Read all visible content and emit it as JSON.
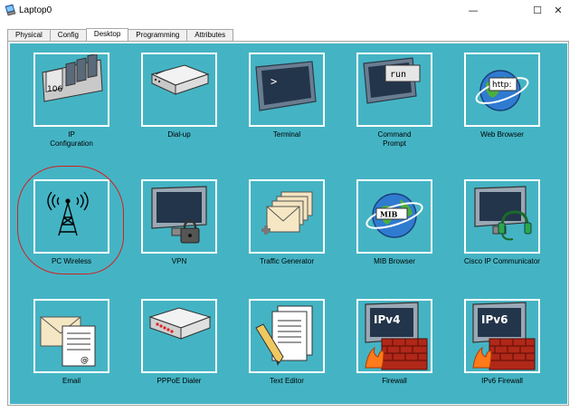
{
  "window": {
    "title": "Laptop0",
    "minimize_glyph": "—",
    "maximize_glyph": "☐",
    "close_glyph": "✕"
  },
  "tabs": [
    {
      "label": "Physical",
      "active": false
    },
    {
      "label": "Config",
      "active": false
    },
    {
      "label": "Desktop",
      "active": true
    },
    {
      "label": "Programming",
      "active": false
    },
    {
      "label": "Attributes",
      "active": false
    }
  ],
  "apps": [
    {
      "label": "IP\nConfiguration",
      "icon": "ip-config-icon",
      "icon_text": "106"
    },
    {
      "label": "Dial-up",
      "icon": "modem-icon"
    },
    {
      "label": "Terminal",
      "icon": "terminal-icon",
      "icon_text": ">"
    },
    {
      "label": "Command\nPrompt",
      "icon": "command-prompt-icon",
      "icon_text": "run"
    },
    {
      "label": "Web Browser",
      "icon": "globe-icon",
      "icon_text": "http:"
    },
    {
      "label": "PC Wireless",
      "icon": "wireless-tower-icon"
    },
    {
      "label": "VPN",
      "icon": "vpn-lock-icon"
    },
    {
      "label": "Traffic Generator",
      "icon": "envelopes-icon"
    },
    {
      "label": "MIB Browser",
      "icon": "mib-globe-icon",
      "icon_text": "MIB"
    },
    {
      "label": "Cisco IP Communicator",
      "icon": "headset-monitor-icon"
    },
    {
      "label": "Email",
      "icon": "email-icon",
      "icon_text": "@"
    },
    {
      "label": "PPPoE Dialer",
      "icon": "pppoe-device-icon"
    },
    {
      "label": "Text Editor",
      "icon": "text-editor-icon"
    },
    {
      "label": "Firewall",
      "icon": "firewall-icon",
      "icon_text": "IPv4"
    },
    {
      "label": "IPv6 Firewall",
      "icon": "ipv6-firewall-icon",
      "icon_text": "IPv6"
    }
  ],
  "colors": {
    "desktop_bg": "#44b4c4",
    "highlight": "#d51f1f",
    "tile_border": "#ffffff"
  }
}
